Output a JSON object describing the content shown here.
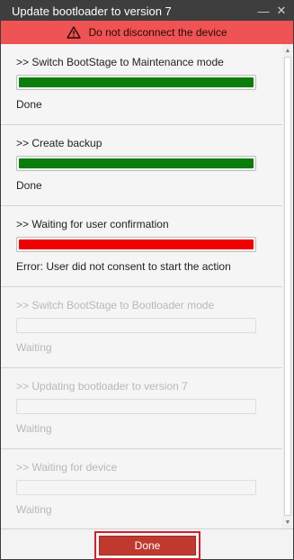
{
  "window": {
    "title": "Update bootloader to version 7",
    "minimize_glyph": "—",
    "close_glyph": "✕"
  },
  "warning": {
    "text": "Do not disconnect the device",
    "icon": "warning-triangle-icon",
    "background": "#ef5353"
  },
  "colors": {
    "success": "#0a7d0a",
    "error": "#ee0000",
    "pending_text": "#b8b8b8"
  },
  "steps": [
    {
      "label": ">> Switch BootStage to Maintenance mode",
      "status": "Done",
      "state": "success",
      "progress": 1.0
    },
    {
      "label": ">> Create backup",
      "status": "Done",
      "state": "success",
      "progress": 1.0
    },
    {
      "label": ">> Waiting for user confirmation",
      "status": "Error: User did not consent to start the action",
      "state": "error",
      "progress": 1.0
    },
    {
      "label": ">> Switch BootStage to Bootloader mode",
      "status": "Waiting",
      "state": "pending",
      "progress": 0
    },
    {
      "label": ">> Updating bootloader to version 7",
      "status": "Waiting",
      "state": "pending",
      "progress": 0
    },
    {
      "label": ">> Waiting for device",
      "status": "Waiting",
      "state": "pending",
      "progress": 0
    }
  ],
  "footer": {
    "done_label": "Done"
  }
}
